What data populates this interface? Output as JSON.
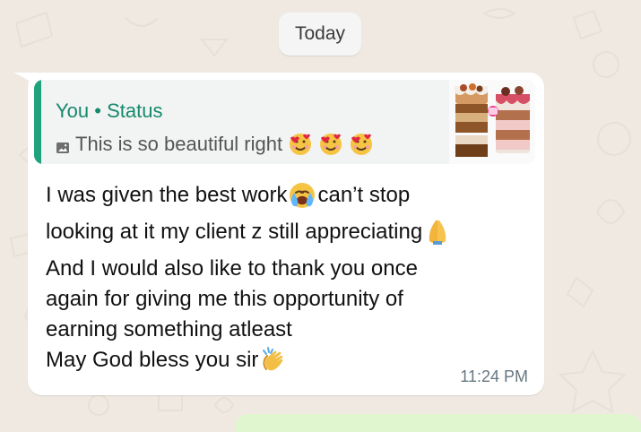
{
  "date_label": "Today",
  "quote": {
    "sender": "You",
    "separator": " • ",
    "context": "Status",
    "preview_text": "This is so beautiful right",
    "preview_media_icon": "photo-icon",
    "preview_emojis": [
      "face-with-hearts-emoji",
      "face-with-hearts-emoji",
      "face-with-hearts-emoji"
    ]
  },
  "message": {
    "lines": [
      "I was given the best work",
      "can’t stop",
      "looking at it my client z still appreciating",
      "And I would also like to thank you once",
      "again for giving me this opportunity of",
      "earning something atleast",
      "May God bless you sir"
    ],
    "emojis": [
      "crying-face-emoji",
      "folded-hands-emoji",
      "clapping-hands-emoji"
    ],
    "time": "11:24 PM"
  },
  "colors": {
    "wallpaper": "#efe9e1",
    "bubble": "#ffffff",
    "quote_bar": "#1fa37f",
    "quote_title": "#15896b",
    "time": "#667781",
    "outgoing_bubble": "#dff6cf"
  }
}
